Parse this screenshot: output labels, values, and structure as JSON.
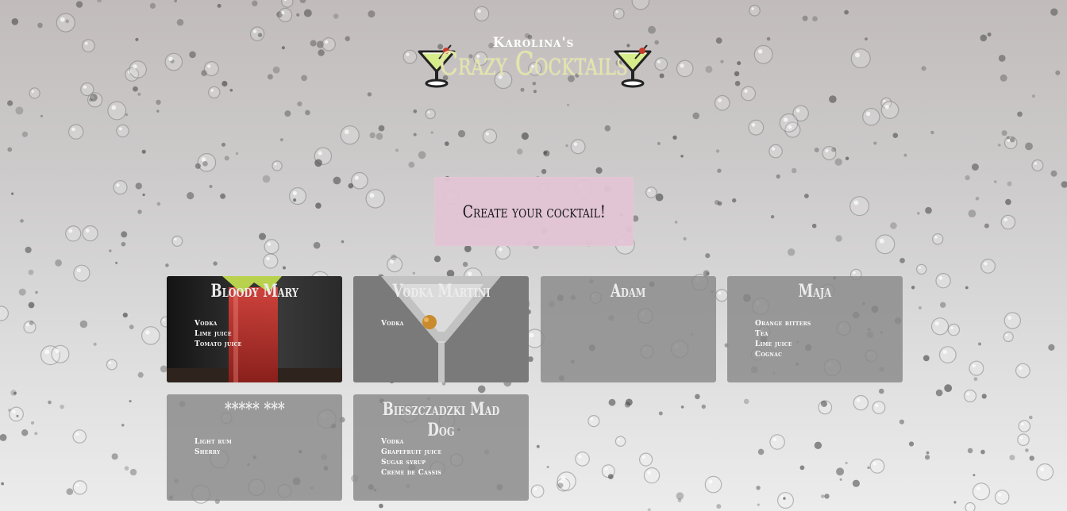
{
  "header": {
    "subtitle": "Karolina's",
    "title": "Crazy Cocktails",
    "glass_icon": "martini-glass-icon"
  },
  "create_button": {
    "label": "Create your cocktail!"
  },
  "cocktails": [
    {
      "name": "Bloody Mary",
      "ingredients": [
        "Vodka",
        "Lime juice",
        "Tomato juice"
      ],
      "image": "bloody-mary-photo"
    },
    {
      "name": "Vodka Martini",
      "ingredients": [
        "Vodka"
      ],
      "image": "martini-glass-photo"
    },
    {
      "name": "Adam",
      "ingredients": []
    },
    {
      "name": "Maja",
      "ingredients": [
        "Orange bitters",
        "Tea",
        "Lime juice",
        "Cognac"
      ]
    },
    {
      "name": "***** ***",
      "ingredients": [
        "Light rum",
        "Sherry"
      ]
    },
    {
      "name": "Bieszczadzki Mad Dog",
      "ingredients": [
        "Vodka",
        "Grapefruit juice",
        "Sugar syrup",
        "Creme de Cassis"
      ]
    }
  ],
  "colors": {
    "title": "#e4e6a6",
    "create_button_bg": "#e2c4d5",
    "card_bg": "#898989"
  }
}
